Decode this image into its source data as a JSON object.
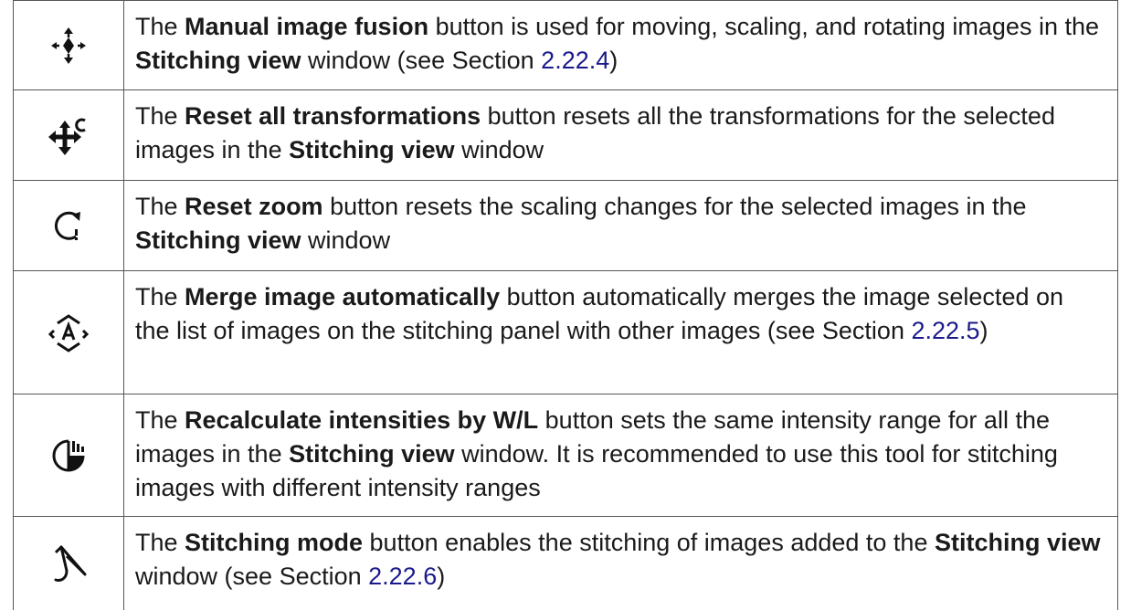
{
  "rows": [
    {
      "icon": "manual-image-fusion-icon",
      "p1": "The ",
      "b1": "Manual image fusion",
      "p2": " button is used for moving, scaling, and rotating images in the ",
      "b2": "Stitching view",
      "p3": " window (see Section ",
      "link": "2.22.4",
      "p4": ")"
    },
    {
      "icon": "reset-all-transformations-icon",
      "p1": "The ",
      "b1": "Reset all transformations",
      "p2": " button resets all the transformations for the selected images in the ",
      "b2": "Stitching view",
      "p3": " window"
    },
    {
      "icon": "reset-zoom-icon",
      "p1": "The ",
      "b1": "Reset zoom",
      "p2": " button resets the scaling changes for the selected images in the ",
      "b2": "Stitching view",
      "p3": " window"
    },
    {
      "icon": "merge-image-automatically-icon",
      "p1": "The ",
      "b1": "Merge image automatically",
      "p2": " button automatically merges the image selected on the list of images on the stitching panel with other images (see Section ",
      "link": "2.22.5",
      "p3": ")"
    },
    {
      "icon": "recalculate-intensities-icon",
      "p1": "The ",
      "b1": "Recalculate intensities by W/L",
      "p2": " button sets the same intensity range for all the images in the ",
      "b2": "Stitching view",
      "p3": " window. It is recommended to use this tool for stitching images with different intensity ranges"
    },
    {
      "icon": "stitching-mode-icon",
      "p1": "The ",
      "b1": "Stitching mode",
      "p2": " button enables the stitching of images added to the ",
      "b2": "Stitching view",
      "p3": " window (see Section ",
      "link": "2.22.6",
      "p4": ")"
    }
  ]
}
